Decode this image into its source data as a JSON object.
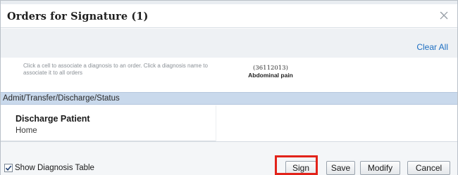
{
  "dialog": {
    "title": "Orders for Signature (1)",
    "close_icon": "close-icon"
  },
  "toolbar": {
    "clear_all_label": "Clear All"
  },
  "diagnosis_header": {
    "instructions": "Click a cell to associate a diagnosis to an order. Click a diagnosis name to associate it to all orders",
    "diagnosis_code": "(36112013)",
    "diagnosis_name": "Abdominal pain"
  },
  "orders": {
    "group_label": "Admit/Transfer/Discharge/Status",
    "items": [
      {
        "name": "Discharge Patient",
        "detail": "Home"
      }
    ]
  },
  "footer": {
    "show_diagnosis_table_label": "Show Diagnosis Table",
    "show_diagnosis_table_checked": true,
    "buttons": {
      "sign": "Sign",
      "save": "Save",
      "modify": "Modify",
      "cancel": "Cancel"
    }
  },
  "colors": {
    "accent_link": "#1e6fc2",
    "group_band": "#c9d9ec",
    "highlight_box": "#e2231a"
  }
}
